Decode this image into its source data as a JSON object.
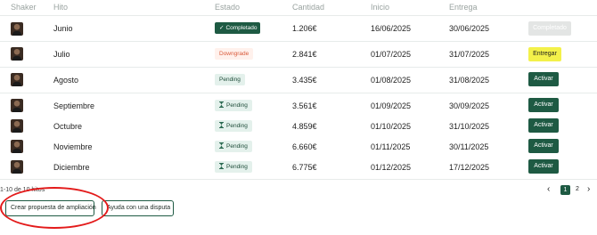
{
  "columns": {
    "shaker": "Shaker",
    "hito": "Hito",
    "estado": "Estado",
    "cantidad": "Cantidad",
    "inicio": "Inicio",
    "entrega": "Entrega"
  },
  "rows": [
    {
      "hito": "Junio",
      "estado": "Completado",
      "estado_glyph": "✓",
      "cantidad": "1.206€",
      "inicio": "16/06/2025",
      "entrega": "30/06/2025",
      "action": "Completado"
    },
    {
      "hito": "Julio",
      "estado": "Downgrade",
      "estado_glyph": "",
      "cantidad": "2.841€",
      "inicio": "01/07/2025",
      "entrega": "31/07/2025",
      "action": "Entregar"
    },
    {
      "hito": "Agosto",
      "estado": "Pending",
      "estado_glyph": "",
      "cantidad": "3.435€",
      "inicio": "01/08/2025",
      "entrega": "31/08/2025",
      "action": "Activar"
    },
    {
      "hito": "Septiembre",
      "estado": "Pending",
      "estado_glyph": "hourglass",
      "cantidad": "3.561€",
      "inicio": "01/09/2025",
      "entrega": "30/09/2025",
      "action": "Activar"
    },
    {
      "hito": "Octubre",
      "estado": "Pending",
      "estado_glyph": "hourglass",
      "cantidad": "4.859€",
      "inicio": "01/10/2025",
      "entrega": "31/10/2025",
      "action": "Activar"
    },
    {
      "hito": "Noviembre",
      "estado": "Pending",
      "estado_glyph": "hourglass",
      "cantidad": "6.660€",
      "inicio": "01/11/2025",
      "entrega": "30/11/2025",
      "action": "Activar"
    },
    {
      "hito": "Diciembre",
      "estado": "Pending",
      "estado_glyph": "hourglass",
      "cantidad": "6.775€",
      "inicio": "01/12/2025",
      "entrega": "17/12/2025",
      "action": "Activar"
    }
  ],
  "footer": {
    "count": "1-10 de 10 hitos",
    "pages": [
      "1",
      "2"
    ],
    "current_page": "1",
    "prev": "‹",
    "next": "›"
  },
  "actions": {
    "crear_propuesta": "Crear propuesta de ampliación",
    "ayuda_disputa": "Ayuda con una disputa"
  },
  "colors": {
    "primary": "#1e5a43",
    "highlight_yellow": "#f3f14a",
    "annotation_red": "#e31b1b",
    "downgrade_text": "#d95a3a"
  }
}
